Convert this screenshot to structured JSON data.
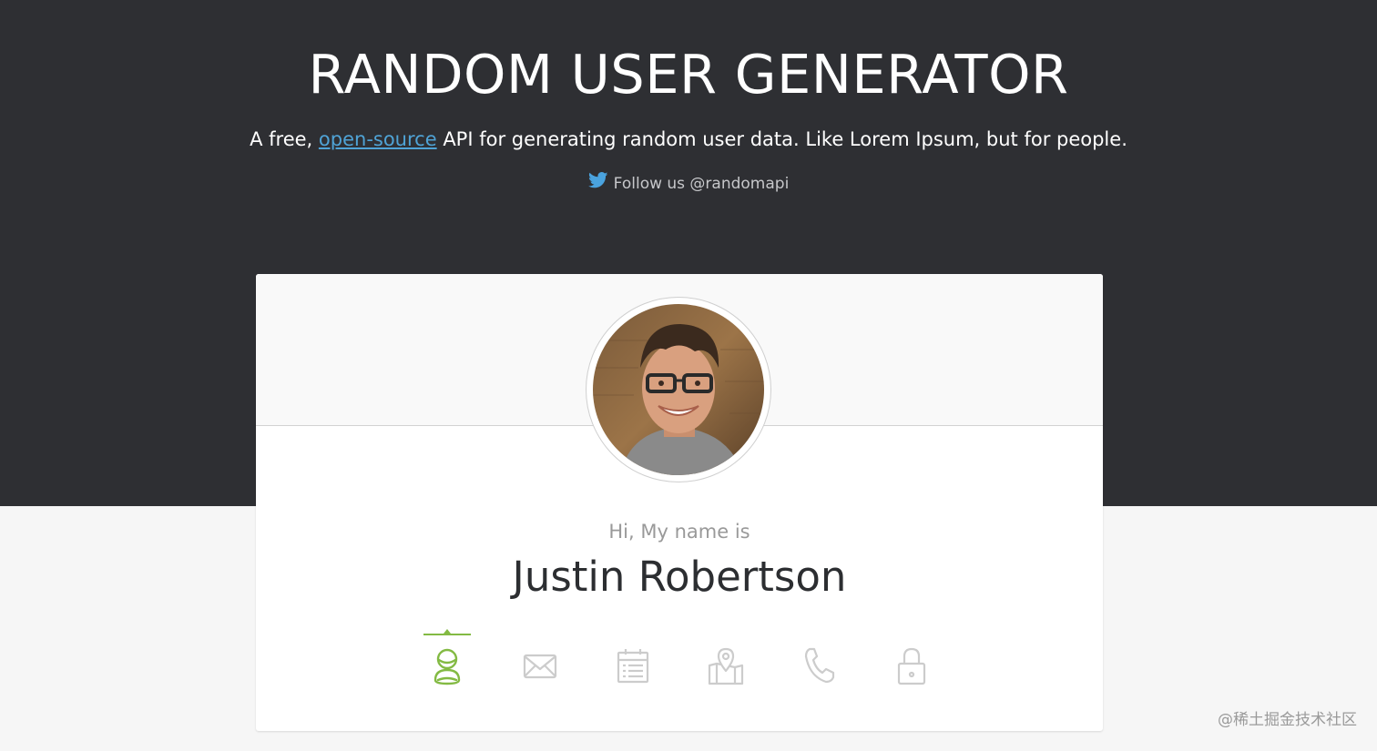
{
  "header": {
    "title": "RANDOM USER GENERATOR",
    "subtitle_prefix": "A free, ",
    "subtitle_link": "open-source",
    "subtitle_suffix": " API for generating random user data. Like Lorem Ipsum, but for people.",
    "follow_text": "Follow us @randomapi",
    "follow_icon": "twitter-icon"
  },
  "user": {
    "greeting": "Hi, My name is",
    "name": "Justin Robertson"
  },
  "tabs": [
    {
      "icon": "user-icon",
      "active": true
    },
    {
      "icon": "envelope-icon",
      "active": false
    },
    {
      "icon": "calendar-icon",
      "active": false
    },
    {
      "icon": "map-pin-icon",
      "active": false
    },
    {
      "icon": "phone-icon",
      "active": false
    },
    {
      "icon": "lock-icon",
      "active": false
    }
  ],
  "colors": {
    "hero_bg": "#2e2f33",
    "link": "#4fa3d6",
    "accent_active": "#83ba43",
    "icon_inactive": "#cccccc",
    "twitter": "#4aa3df"
  },
  "watermark": "@稀土掘金技术社区"
}
